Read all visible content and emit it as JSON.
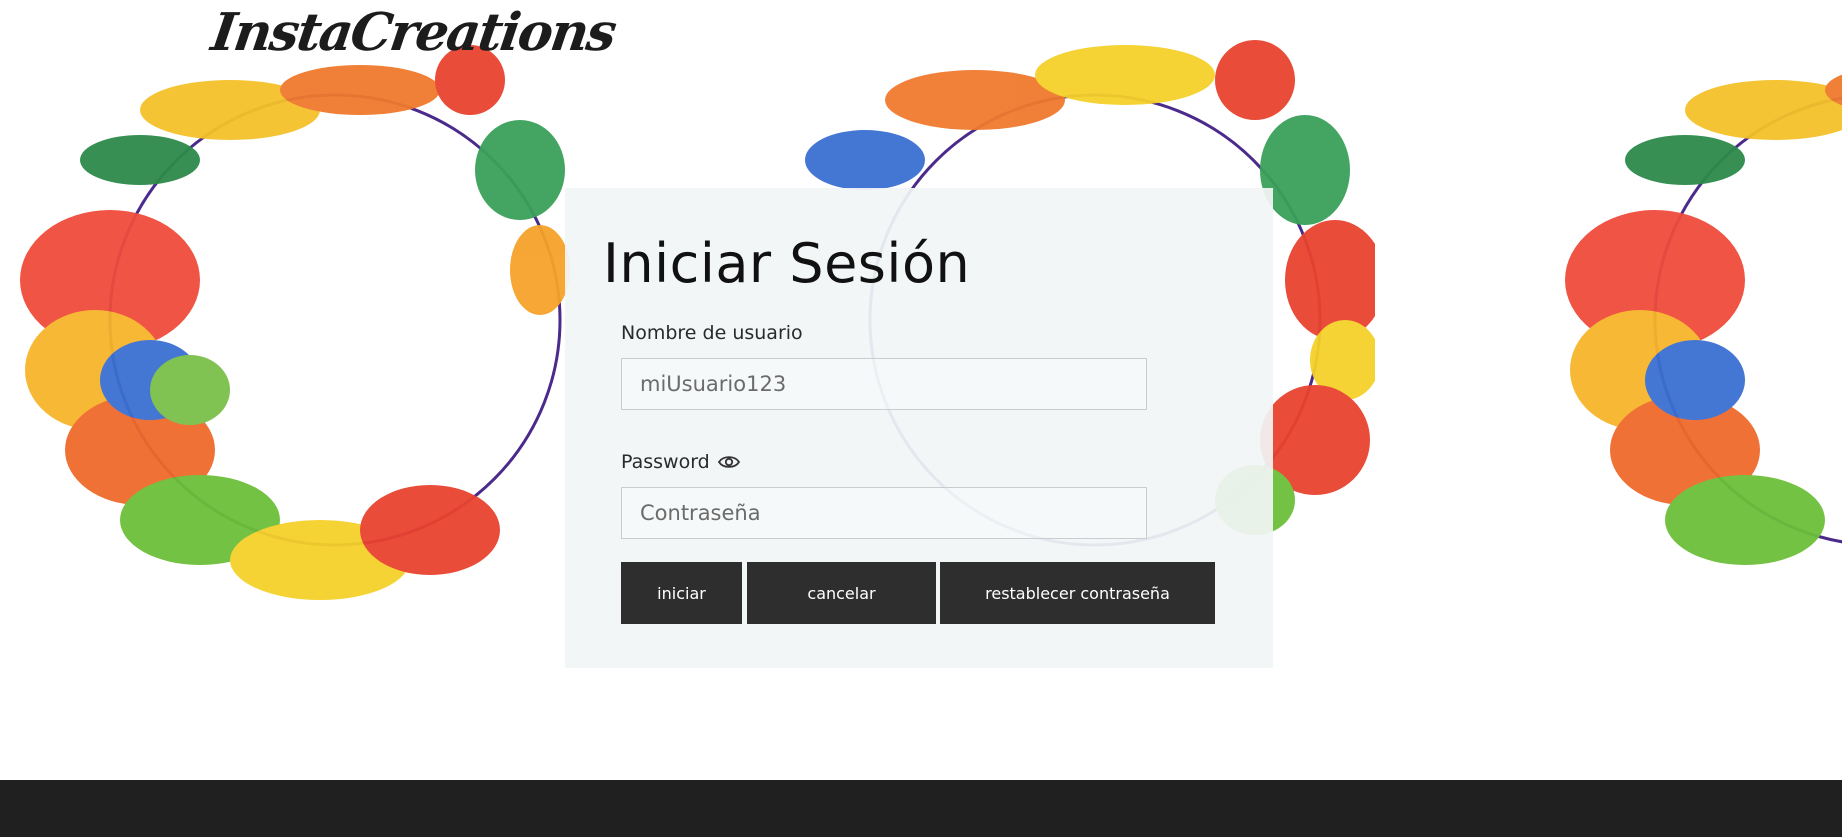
{
  "brand": {
    "name": "InstaCreations"
  },
  "login": {
    "title": "Iniciar Sesión",
    "username_label": "Nombre de usuario",
    "username_placeholder": "miUsuario123",
    "password_label": "Password",
    "password_placeholder": "Contraseña",
    "buttons": {
      "login": "iniciar",
      "cancel": "cancelar",
      "reset": "restablecer contraseña"
    }
  },
  "icons": {
    "password_toggle": "eye-icon"
  },
  "colors": {
    "card_background": "#f1f5f5",
    "button_background": "#2e2e2e",
    "button_text": "#ffffff",
    "footer_background": "#202020"
  }
}
